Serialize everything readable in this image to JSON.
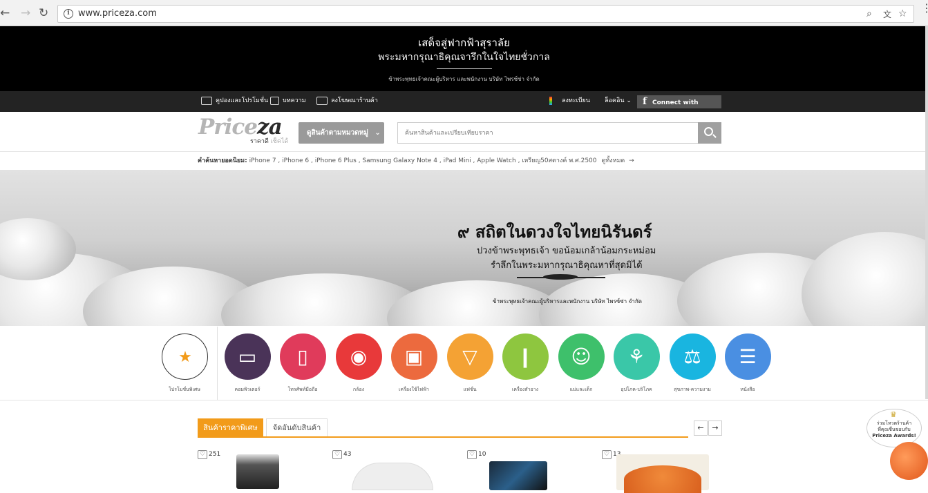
{
  "browser": {
    "url": "www.priceza.com",
    "back_glyph": "←",
    "forward_glyph": "→",
    "reload_glyph": "↻",
    "zoom_glyph": "⌕",
    "translate_glyph": "文",
    "star_glyph": "☆"
  },
  "mourning_banner": {
    "line1": "เสด็จสู่ฟากฟ้าสุราลัย",
    "line2": "พระมหากรุณาธิคุณจารึกในใจไทยชั่วกาล",
    "line3": "ข้าพระพุทธเจ้าคณะผู้บริหาร และพนักงาน บริษัท ไพรซ์ซ่า จำกัด"
  },
  "topbar": {
    "coupons": "คูปองและโปรโมชั่น",
    "articles": "บทความ",
    "advertise": "ลงโฆษณาร้านค้า",
    "register": "ลงทะเบียน",
    "login": "ล็อคอิน",
    "login_arrow": "⌄",
    "facebook_f": "f",
    "facebook": "Connect with facebook"
  },
  "header": {
    "logo_part1": "Price",
    "logo_part2": "za",
    "tagline_part1": "ราคาดี",
    "tagline_part2": "เช็คได้",
    "category_button": "ดูสินค้าตามหมวดหมู่",
    "category_arrow": "⌄",
    "search_placeholder": "ค้นหาสินค้าและเปรียบเทียบราคา"
  },
  "popular": {
    "label": "คำค้นหายอดนิยม:",
    "terms": "iPhone 7 , iPhone 6 , iPhone 6 Plus , Samsung Galaxy Note 4 , iPad Mini , Apple Watch , เหรียญ50สตางค์ พ.ศ.2500",
    "see_all": "ดูทั้งหมด",
    "see_all_arrow": "→"
  },
  "hero": {
    "title": "๙ สถิตในดวงใจไทยนิรันดร์",
    "line1": "ปวงข้าพระพุทธเจ้า ขอน้อมเกล้าน้อมกระหม่อม",
    "line2": "รำลึกในพระมหากรุณาธิคุณหาที่สุดมิได้",
    "signature": "ข้าพระพุทธเจ้าคณะผู้บริหารและพนักงาน บริษัท ไพรซ์ซ่า จำกัด"
  },
  "categories": [
    {
      "label": "โปรโมชั่นพิเศษ",
      "color": "#ffffff",
      "icon": "tag-icon",
      "glyph": "★"
    },
    {
      "label": "คอมพิวเตอร์",
      "color": "#4a3358",
      "icon": "computer-icon",
      "glyph": "▭"
    },
    {
      "label": "โทรศัพท์มือถือ",
      "color": "#e03b5b",
      "icon": "phone-icon",
      "glyph": "▯"
    },
    {
      "label": "กล้อง",
      "color": "#e8393a",
      "icon": "camera-icon",
      "glyph": "◉"
    },
    {
      "label": "เครื่องใช้ไฟฟ้า",
      "color": "#ec6a3e",
      "icon": "washer-icon",
      "glyph": "▣"
    },
    {
      "label": "แฟชั่น",
      "color": "#f4a234",
      "icon": "bag-icon",
      "glyph": "▽"
    },
    {
      "label": "เครื่องสำอาง",
      "color": "#8ec63f",
      "icon": "cosmetics-icon",
      "glyph": "❙"
    },
    {
      "label": "แม่และเด็ก",
      "color": "#3ec06b",
      "icon": "baby-icon",
      "glyph": "☺"
    },
    {
      "label": "อุปโภค-บริโภค",
      "color": "#3ac7a8",
      "icon": "bottles-icon",
      "glyph": "⚘"
    },
    {
      "label": "สุขภาพ-ความงาม",
      "color": "#19b5e0",
      "icon": "scale-icon",
      "glyph": "⚖"
    },
    {
      "label": "หนังสือ",
      "color": "#4a8fe2",
      "icon": "books-icon",
      "glyph": "☰"
    }
  ],
  "products": {
    "tab_active": "สินค้าราคาพิเศษ",
    "tab_inactive": "จัดอันดับสินค้า",
    "prev_glyph": "←",
    "next_glyph": "→",
    "heart_glyph": "♡",
    "items": [
      {
        "likes": "251"
      },
      {
        "likes": "43"
      },
      {
        "likes": "10"
      },
      {
        "likes": "13"
      }
    ]
  },
  "awards": {
    "line1": "ร่วมโหวตร้านค้า",
    "line2": "ที่คุณชื่นชอบกับ",
    "line3": "Priceza Awards!"
  }
}
